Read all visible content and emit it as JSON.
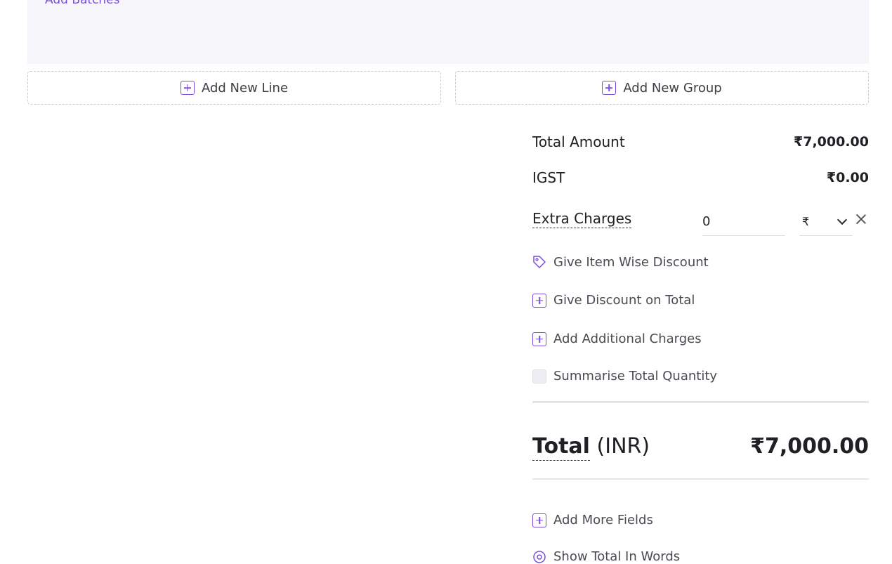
{
  "batches": {
    "link_label": "Add Batches"
  },
  "add_buttons": {
    "line_label": "Add New Line",
    "group_label": "Add New Group"
  },
  "summary": {
    "total_amount_label": "Total Amount",
    "total_amount_value": "₹7,000.00",
    "igst_label": "IGST",
    "igst_value": "₹0.00",
    "extra_charges_label": "Extra Charges",
    "extra_charges_value": "0",
    "extra_charges_currency": "₹"
  },
  "actions": {
    "item_wise_discount": "Give Item Wise Discount",
    "discount_on_total": "Give Discount on Total",
    "additional_charges": "Add Additional Charges",
    "summarise_quantity": "Summarise Total Quantity"
  },
  "total": {
    "label": "Total",
    "currency": "(INR)",
    "value": "₹7,000.00"
  },
  "footer_actions": {
    "add_more_fields": "Add More Fields",
    "show_total_in_words": "Show Total In Words"
  },
  "colors": {
    "accent": "#7c4ddb",
    "panel_bg": "#f6f6fa"
  }
}
